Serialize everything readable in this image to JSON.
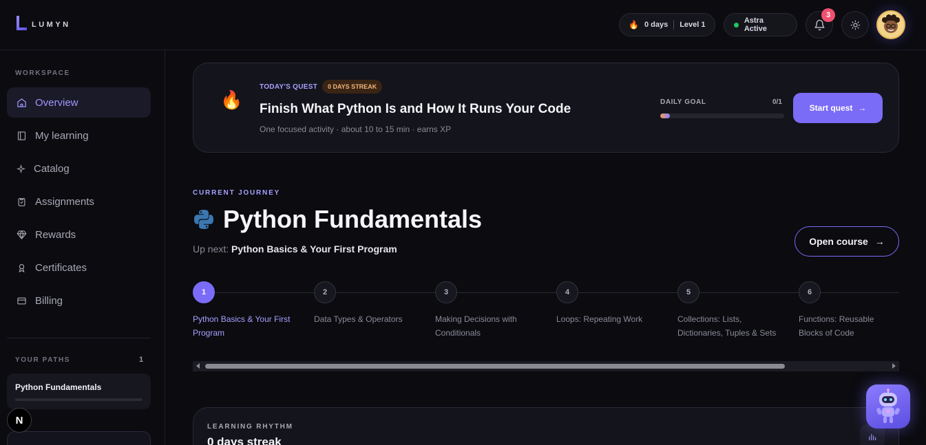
{
  "brand": {
    "name": "LUMYN"
  },
  "header": {
    "streak": "0 days",
    "level": "Level 1",
    "astra_status": "Astra Active",
    "notification_count": "3"
  },
  "sidebar": {
    "workspace_heading": "WORKSPACE",
    "items": [
      {
        "label": "Overview",
        "icon": "home-icon",
        "active": true
      },
      {
        "label": "My learning",
        "icon": "book-icon"
      },
      {
        "label": "Catalog",
        "icon": "sparkle-icon"
      },
      {
        "label": "Assignments",
        "icon": "clipboard-icon"
      },
      {
        "label": "Rewards",
        "icon": "gem-icon"
      },
      {
        "label": "Certificates",
        "icon": "award-icon"
      },
      {
        "label": "Billing",
        "icon": "credit-card-icon"
      }
    ],
    "paths_heading": "YOUR PATHS",
    "paths_count": "1",
    "path_name": "Python Fundamentals",
    "path_progress": 0,
    "next_badge": "N"
  },
  "quest": {
    "label": "TODAY'S QUEST",
    "streak_tag": "0 DAYS STREAK",
    "title": "Finish What Python Is and How It Runs Your Code",
    "subtitle": "One focused activity · about 10 to 15 min · earns XP",
    "goal_label": "DAILY GOAL",
    "goal_value": "0/1",
    "goal_progress": 0.08,
    "button": "Start quest"
  },
  "journey": {
    "label": "CURRENT JOURNEY",
    "course_title": "Python Fundamentals",
    "up_next_prefix": "Up next:",
    "up_next_value": "Python Basics & Your First Program",
    "open_button": "Open course",
    "steps": [
      {
        "num": "1",
        "label": "Python Basics & Your First Program"
      },
      {
        "num": "2",
        "label": "Data Types & Operators"
      },
      {
        "num": "3",
        "label": "Making Decisions with Conditionals"
      },
      {
        "num": "4",
        "label": "Loops: Repeating Work"
      },
      {
        "num": "5",
        "label": "Collections: Lists, Dictionaries, Tuples & Sets"
      },
      {
        "num": "6",
        "label": "Functions: Reusable Blocks of Code"
      }
    ]
  },
  "rhythm": {
    "label": "LEARNING RHYTHM",
    "value": "0 days streak"
  },
  "colors": {
    "accent": "#7a6cf6",
    "accent_text": "#a8a0ff",
    "background": "#0b0b10",
    "status_green": "#22c55e",
    "badge_red": "#f0506e"
  }
}
